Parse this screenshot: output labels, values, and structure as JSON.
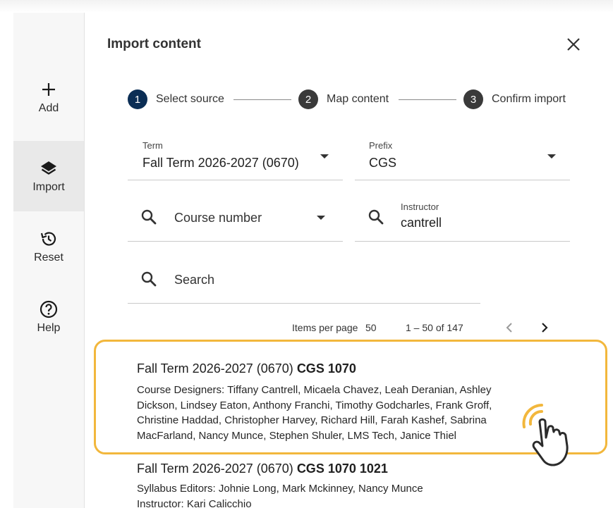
{
  "rail": {
    "items": [
      {
        "label": "Add",
        "icon": "plus-icon"
      },
      {
        "label": "Import",
        "icon": "layers-icon",
        "active": true
      },
      {
        "label": "Reset",
        "icon": "history-icon"
      },
      {
        "label": "Help",
        "icon": "help-circle-icon"
      }
    ]
  },
  "dialog": {
    "title": "Import content",
    "close_icon": "close-icon"
  },
  "stepper": {
    "steps": [
      {
        "number": "1",
        "label": "Select source"
      },
      {
        "number": "2",
        "label": "Map content"
      },
      {
        "number": "3",
        "label": "Confirm import"
      }
    ]
  },
  "filters": {
    "term": {
      "label": "Term",
      "value": "Fall Term 2026-2027 (0670)"
    },
    "prefix": {
      "label": "Prefix",
      "value": "CGS"
    },
    "course_number": {
      "placeholder": "Course number"
    },
    "instructor": {
      "label": "Instructor",
      "value": "cantrell"
    },
    "search": {
      "placeholder": "Search"
    }
  },
  "pagination": {
    "items_per_page_label": "Items per page",
    "items_per_page": "50",
    "range": "1 – 50 of 147"
  },
  "results": [
    {
      "term": "Fall Term 2026-2027 (0670)",
      "course": "CGS 1070",
      "details": "Course Designers: Tiffany Cantrell, Micaela Chavez, Leah Deranian, Ashley Dickson, Lindsey Eaton, Anthony Franchi, Timothy Godcharles, Frank Groff, Christine Haddad, Christopher Harvey, Richard Hill, Farah Kashef, Sabrina MacFarland, Nancy Munce, Stephen Shuler, LMS Tech, Janice Thiel"
    },
    {
      "term": "Fall Term 2026-2027 (0670)",
      "course": "CGS 1070 1021",
      "details": "Syllabus Editors: Johnie Long, Mark Mckinney, Nancy Munce",
      "details2": "Instructor: Kari Calicchio"
    }
  ],
  "colors": {
    "step_active": "#0b2e55",
    "step_inactive": "#3a3a3a",
    "highlight": "#f2b73c"
  }
}
